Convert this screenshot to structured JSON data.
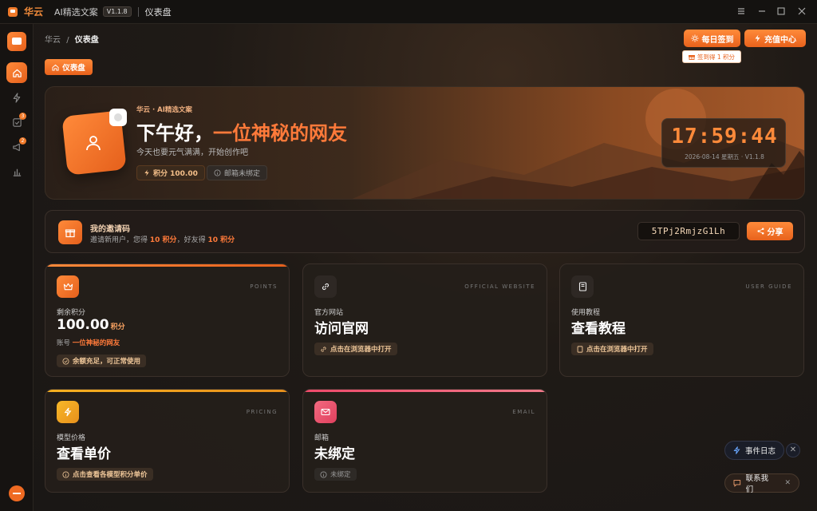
{
  "titlebar": {
    "brand": "华云",
    "app_name": "AI精选文案",
    "version": "V1.1.8",
    "page": "仪表盘"
  },
  "sidebar": {
    "items": [
      {
        "icon": "home-icon",
        "active": true
      },
      {
        "icon": "lightning-icon"
      },
      {
        "icon": "task-check-icon",
        "badge": "3"
      },
      {
        "icon": "megaphone-icon",
        "badge": "2"
      },
      {
        "icon": "bar-chart-icon"
      }
    ]
  },
  "header": {
    "breadcrumb_root": "华云",
    "breadcrumb_sep": "/",
    "breadcrumb_current": "仪表盘",
    "checkin_label": "每日签到",
    "recharge_label": "充值中心",
    "checkin_tip": "签到得 1 积分",
    "tab_label": "仪表盘"
  },
  "hero": {
    "subtitle": "华云 · AI精选文案",
    "greeting": "下午好，",
    "username": "一位神秘的网友",
    "description": "今天也要元气满满，开始创作吧",
    "points_chip": "积分 100.00",
    "email_chip": "邮箱未绑定",
    "clock_time": "17:59:44",
    "clock_date": "2026-08-14 星期五 · V1.1.8"
  },
  "invite": {
    "title": "我的邀请码",
    "desc_prefix": "邀请新用户，您得",
    "desc_reward1": "10 积分",
    "desc_mid": "，好友得",
    "desc_reward2": "10 积分",
    "code": "5TPj2RmjzG1Lh",
    "share_label": "分享"
  },
  "cards": {
    "points": {
      "tag": "POINTS",
      "label": "剩余积分",
      "value": "100.00",
      "unit": "积分",
      "account_prefix": "账号",
      "account_name": "一位神秘的网友",
      "chip": "余额充足，可正常使用"
    },
    "website": {
      "tag": "OFFICIAL WEBSITE",
      "label": "官方网站",
      "value": "访问官网",
      "chip": "点击在浏览器中打开"
    },
    "guide": {
      "tag": "USER GUIDE",
      "label": "使用教程",
      "value": "查看教程",
      "chip": "点击在浏览器中打开"
    },
    "pricing": {
      "tag": "PRICING",
      "label": "模型价格",
      "value": "查看单价",
      "chip": "点击查看各模型积分单价"
    },
    "email": {
      "tag": "EMAIL",
      "label": "邮箱",
      "value": "未绑定",
      "chip": "未绑定"
    }
  },
  "floating": {
    "event_log": "事件日志",
    "contact": "联系我们"
  },
  "colors": {
    "accent": "#ff7a3a",
    "accent_dark": "#e5601c",
    "pricing_accent": "#f5b020",
    "email_accent": "#ee4a6a"
  }
}
